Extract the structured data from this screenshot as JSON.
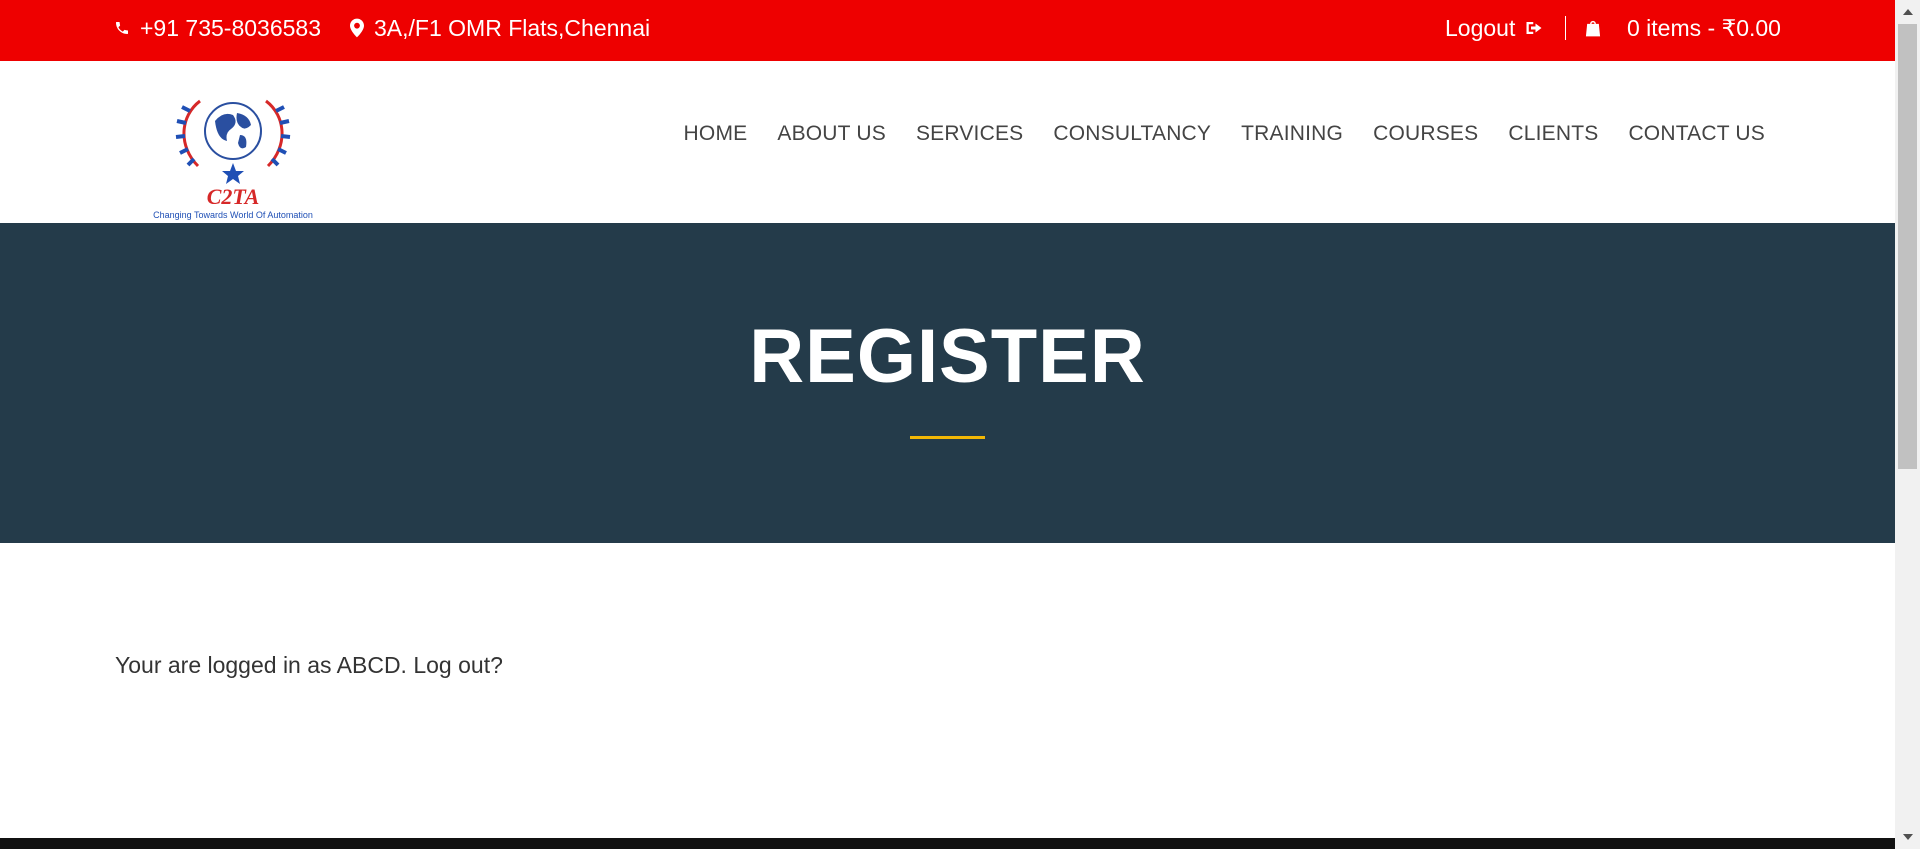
{
  "topbar": {
    "phone": "+91 735-8036583",
    "address": "3A,/F1 OMR Flats,Chennai",
    "logout": "Logout",
    "cart": "0 items - ₹0.00",
    "icons": [
      "phone-icon",
      "map-marker-icon",
      "logout-icon",
      "shopping-bag-icon"
    ],
    "background": "#ee0000"
  },
  "logo": {
    "mark": "C2TA",
    "tagline": "Changing Towards World Of Automation"
  },
  "nav": {
    "items": [
      "HOME",
      "ABOUT US",
      "SERVICES",
      "CONSULTANCY",
      "TRAINING",
      "COURSES",
      "CLIENTS",
      "CONTACT US"
    ]
  },
  "banner": {
    "title": "REGISTER",
    "background": "#243b4a",
    "accent": "#f2b705"
  },
  "content": {
    "prefix": "Your are logged in as ABCD.",
    "logout_link": "Log out?"
  }
}
